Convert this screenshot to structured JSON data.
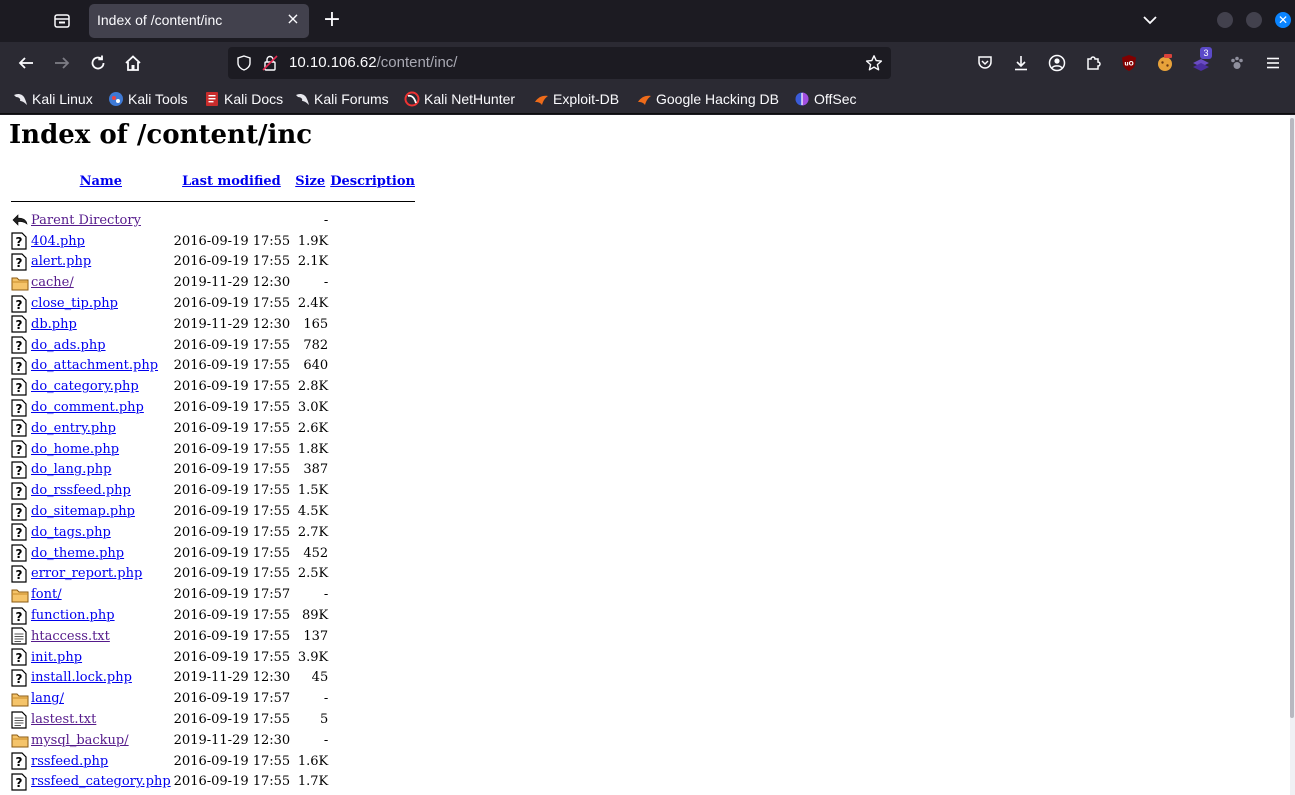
{
  "browser": {
    "tab_title": "Index of /content/inc",
    "tab_close": "×",
    "new_tab": "+",
    "url_host": "10.10.106.62",
    "url_path": "/content/inc/",
    "extension_badge": "3",
    "accent_color": "#0a84ff"
  },
  "bookmarks": [
    {
      "label": "Kali Linux",
      "icon": "kali-dragon-icon"
    },
    {
      "label": "Kali Tools",
      "icon": "kali-tools-icon"
    },
    {
      "label": "Kali Docs",
      "icon": "kali-docs-icon"
    },
    {
      "label": "Kali Forums",
      "icon": "kali-dragon-icon"
    },
    {
      "label": "Kali NetHunter",
      "icon": "nethunter-icon"
    },
    {
      "label": "Exploit-DB",
      "icon": "exploit-db-icon"
    },
    {
      "label": "Google Hacking DB",
      "icon": "ghdb-icon"
    },
    {
      "label": "OffSec",
      "icon": "offsec-icon"
    }
  ],
  "page": {
    "title": "Index of /content/inc",
    "columns": {
      "name": "Name",
      "last_modified": "Last modified",
      "size": "Size",
      "description": "Description"
    },
    "parent": {
      "name": "Parent Directory",
      "size": "-"
    },
    "rows": [
      {
        "name": "404.php",
        "date": "2016-09-19 17:55",
        "size": "1.9K",
        "icon": "unknown-file-icon"
      },
      {
        "name": "alert.php",
        "date": "2016-09-19 17:55",
        "size": "2.1K",
        "icon": "unknown-file-icon"
      },
      {
        "name": "cache/",
        "date": "2019-11-29 12:30",
        "size": "-",
        "icon": "folder-icon",
        "visited": true
      },
      {
        "name": "close_tip.php",
        "date": "2016-09-19 17:55",
        "size": "2.4K",
        "icon": "unknown-file-icon"
      },
      {
        "name": "db.php",
        "date": "2019-11-29 12:30",
        "size": "165",
        "icon": "unknown-file-icon"
      },
      {
        "name": "do_ads.php",
        "date": "2016-09-19 17:55",
        "size": "782",
        "icon": "unknown-file-icon"
      },
      {
        "name": "do_attachment.php",
        "date": "2016-09-19 17:55",
        "size": "640",
        "icon": "unknown-file-icon"
      },
      {
        "name": "do_category.php",
        "date": "2016-09-19 17:55",
        "size": "2.8K",
        "icon": "unknown-file-icon"
      },
      {
        "name": "do_comment.php",
        "date": "2016-09-19 17:55",
        "size": "3.0K",
        "icon": "unknown-file-icon"
      },
      {
        "name": "do_entry.php",
        "date": "2016-09-19 17:55",
        "size": "2.6K",
        "icon": "unknown-file-icon"
      },
      {
        "name": "do_home.php",
        "date": "2016-09-19 17:55",
        "size": "1.8K",
        "icon": "unknown-file-icon"
      },
      {
        "name": "do_lang.php",
        "date": "2016-09-19 17:55",
        "size": "387",
        "icon": "unknown-file-icon"
      },
      {
        "name": "do_rssfeed.php",
        "date": "2016-09-19 17:55",
        "size": "1.5K",
        "icon": "unknown-file-icon"
      },
      {
        "name": "do_sitemap.php",
        "date": "2016-09-19 17:55",
        "size": "4.5K",
        "icon": "unknown-file-icon"
      },
      {
        "name": "do_tags.php",
        "date": "2016-09-19 17:55",
        "size": "2.7K",
        "icon": "unknown-file-icon"
      },
      {
        "name": "do_theme.php",
        "date": "2016-09-19 17:55",
        "size": "452",
        "icon": "unknown-file-icon"
      },
      {
        "name": "error_report.php",
        "date": "2016-09-19 17:55",
        "size": "2.5K",
        "icon": "unknown-file-icon"
      },
      {
        "name": "font/",
        "date": "2016-09-19 17:57",
        "size": "-",
        "icon": "folder-icon"
      },
      {
        "name": "function.php",
        "date": "2016-09-19 17:55",
        "size": "89K",
        "icon": "unknown-file-icon"
      },
      {
        "name": "htaccess.txt",
        "date": "2016-09-19 17:55",
        "size": "137",
        "icon": "text-file-icon",
        "visited": true
      },
      {
        "name": "init.php",
        "date": "2016-09-19 17:55",
        "size": "3.9K",
        "icon": "unknown-file-icon"
      },
      {
        "name": "install.lock.php",
        "date": "2019-11-29 12:30",
        "size": "45",
        "icon": "unknown-file-icon"
      },
      {
        "name": "lang/",
        "date": "2016-09-19 17:57",
        "size": "-",
        "icon": "folder-icon"
      },
      {
        "name": "lastest.txt",
        "date": "2016-09-19 17:55",
        "size": "5",
        "icon": "text-file-icon",
        "visited": true
      },
      {
        "name": "mysql_backup/",
        "date": "2019-11-29 12:30",
        "size": "-",
        "icon": "folder-icon",
        "visited": true
      },
      {
        "name": "rssfeed.php",
        "date": "2016-09-19 17:55",
        "size": "1.6K",
        "icon": "unknown-file-icon"
      },
      {
        "name": "rssfeed_category.php",
        "date": "2016-09-19 17:55",
        "size": "1.7K",
        "icon": "unknown-file-icon"
      }
    ]
  }
}
